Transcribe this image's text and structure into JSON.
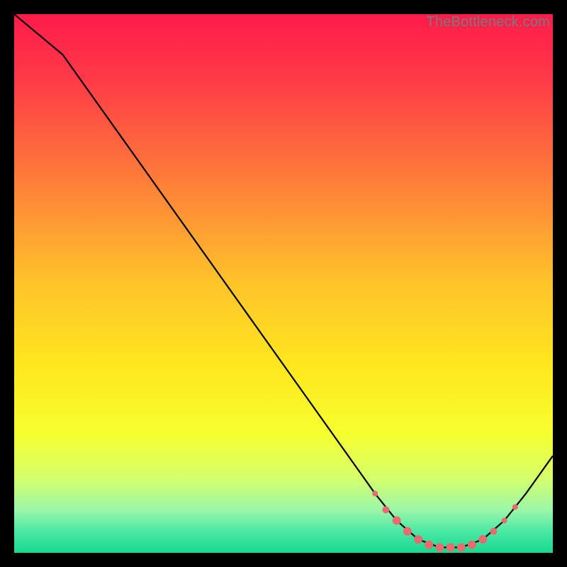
{
  "watermark": "TheBottleneck.com",
  "chart_data": {
    "type": "line",
    "title": "",
    "xlabel": "",
    "ylabel": "",
    "xlim": [
      0,
      100
    ],
    "ylim": [
      0,
      100
    ],
    "curve": {
      "name": "bottleneck-curve",
      "points": [
        {
          "x": 0,
          "y": 100
        },
        {
          "x": 9,
          "y": 92.5
        },
        {
          "x": 67,
          "y": 11
        },
        {
          "x": 71,
          "y": 6
        },
        {
          "x": 75,
          "y": 2.5
        },
        {
          "x": 79,
          "y": 1
        },
        {
          "x": 83,
          "y": 1
        },
        {
          "x": 87,
          "y": 2.5
        },
        {
          "x": 91,
          "y": 6
        },
        {
          "x": 95,
          "y": 11
        },
        {
          "x": 100,
          "y": 18
        }
      ]
    },
    "markers": {
      "name": "highlight-dots",
      "color": "#e96a6f",
      "points": [
        {
          "x": 67,
          "y": 11,
          "r": 4
        },
        {
          "x": 69,
          "y": 8,
          "r": 5
        },
        {
          "x": 71,
          "y": 6,
          "r": 6
        },
        {
          "x": 73,
          "y": 4,
          "r": 6
        },
        {
          "x": 75,
          "y": 2.5,
          "r": 6
        },
        {
          "x": 77,
          "y": 1.5,
          "r": 6
        },
        {
          "x": 79,
          "y": 1,
          "r": 6
        },
        {
          "x": 81,
          "y": 1,
          "r": 6
        },
        {
          "x": 83,
          "y": 1,
          "r": 6
        },
        {
          "x": 85,
          "y": 1.5,
          "r": 6
        },
        {
          "x": 87,
          "y": 2.5,
          "r": 6
        },
        {
          "x": 89,
          "y": 4,
          "r": 5
        },
        {
          "x": 91,
          "y": 6,
          "r": 4
        },
        {
          "x": 93,
          "y": 8.5,
          "r": 4
        }
      ]
    },
    "gradient_stops": [
      {
        "offset": 0.0,
        "color": "#ff1b4b"
      },
      {
        "offset": 0.12,
        "color": "#ff3a47"
      },
      {
        "offset": 0.3,
        "color": "#ff7a3a"
      },
      {
        "offset": 0.5,
        "color": "#ffc42a"
      },
      {
        "offset": 0.66,
        "color": "#ffe81e"
      },
      {
        "offset": 0.78,
        "color": "#f6ff30"
      },
      {
        "offset": 0.86,
        "color": "#d6ff6a"
      },
      {
        "offset": 0.92,
        "color": "#9bf7a8"
      },
      {
        "offset": 0.96,
        "color": "#4be8a5"
      },
      {
        "offset": 1.0,
        "color": "#17d98e"
      }
    ]
  }
}
